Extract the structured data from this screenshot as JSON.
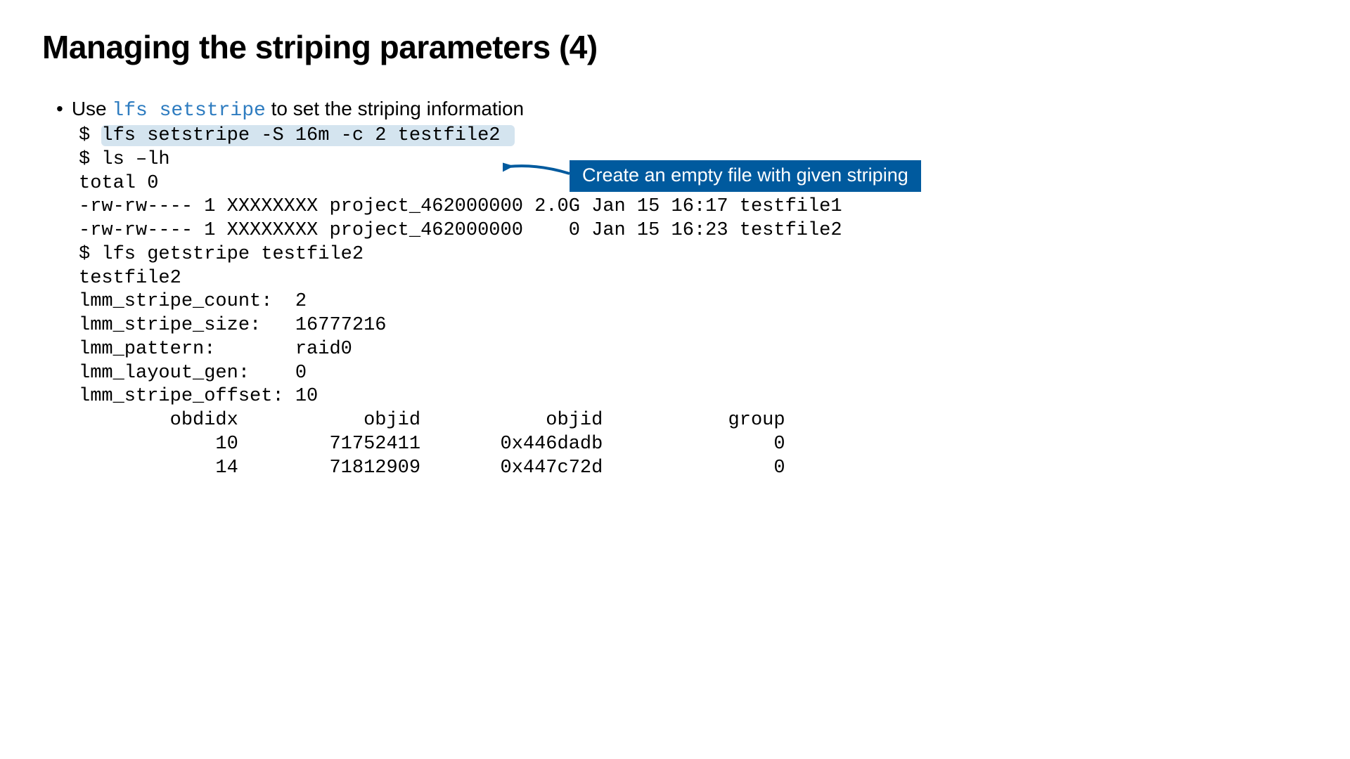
{
  "title": "Managing the striping parameters (4)",
  "bullet": {
    "prefix": "Use ",
    "code": "lfs setstripe",
    "suffix": " to set the striping information"
  },
  "terminal": {
    "line1_prompt": "$ ",
    "line1_cmd": "lfs setstripe -S 16m -c 2 testfile2 ",
    "line2": "$ ls –lh",
    "line3": "total 0",
    "line4": "-rw-rw---- 1 XXXXXXXX project_462000000 2.0G Jan 15 16:17 testfile1",
    "line5": "-rw-rw---- 1 XXXXXXXX project_462000000    0 Jan 15 16:23 testfile2",
    "line6": "$ lfs getstripe testfile2",
    "line7": "testfile2",
    "line8": "lmm_stripe_count:  2",
    "line9": "lmm_stripe_size:   16777216",
    "line10": "lmm_pattern:       raid0",
    "line11": "lmm_layout_gen:    0",
    "line12": "lmm_stripe_offset: 10",
    "line13": "        obdidx           objid           objid           group",
    "line14": "            10        71752411       0x446dadb               0",
    "line15": "            14        71812909       0x447c72d               0"
  },
  "callout": "Create an empty file with given striping",
  "colors": {
    "callout_bg": "#005a9e",
    "highlight_bg": "#d4e4ef",
    "code_color": "#2e7cc0"
  }
}
